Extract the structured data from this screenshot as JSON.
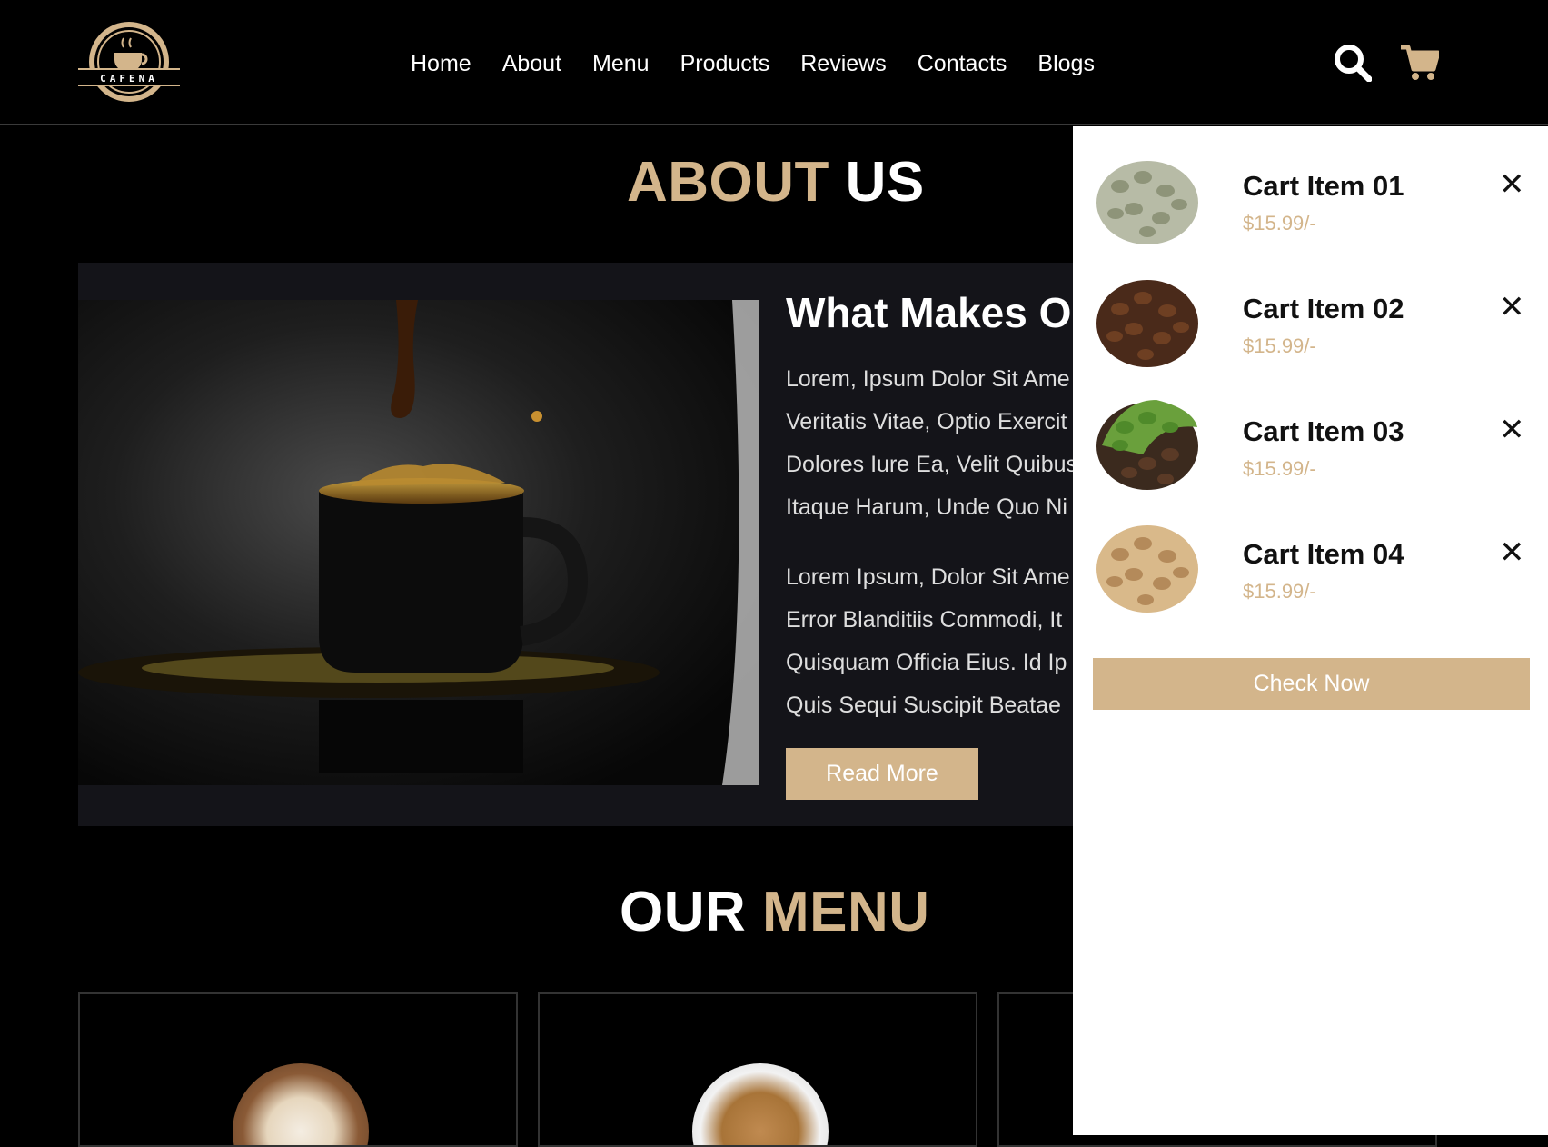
{
  "brand": {
    "logo_text": "CAFENA"
  },
  "nav": {
    "items": [
      "Home",
      "About",
      "Menu",
      "Products",
      "Reviews",
      "Contacts",
      "Blogs"
    ]
  },
  "header_icons": {
    "search": "search-icon",
    "cart": "shopping-cart-icon"
  },
  "about": {
    "title_part1": "ABOUT",
    "title_part2": "US",
    "heading": "What Makes Ou",
    "paragraph1_lines": [
      "Lorem, Ipsum Dolor Sit Ame",
      "Veritatis Vitae, Optio Exercit",
      "Dolores Iure Ea, Velit Quibus",
      "Itaque Harum, Unde Quo Ni"
    ],
    "paragraph2_lines": [
      "Lorem Ipsum, Dolor Sit Ame",
      "Error Blanditiis Commodi, It",
      "Quisquam Officia Eius. Id Ip",
      "Quis Sequi Suscipit Beatae"
    ],
    "read_more_label": "Read More"
  },
  "menu_section": {
    "title_part1": "OUR",
    "title_part2": "MENU"
  },
  "cart": {
    "items": [
      {
        "name": "Cart Item 01",
        "price": "$15.99/-",
        "bean": "green"
      },
      {
        "name": "Cart Item 02",
        "price": "$15.99/-",
        "bean": "dark"
      },
      {
        "name": "Cart Item 03",
        "price": "$15.99/-",
        "bean": "mixed"
      },
      {
        "name": "Cart Item 04",
        "price": "$15.99/-",
        "bean": "light"
      }
    ],
    "remove_symbol": "✕",
    "check_now_label": "Check Now"
  },
  "colors": {
    "accent": "#d3b58b",
    "background": "#000000",
    "panel": "#141419",
    "cart_bg": "#ffffff"
  }
}
